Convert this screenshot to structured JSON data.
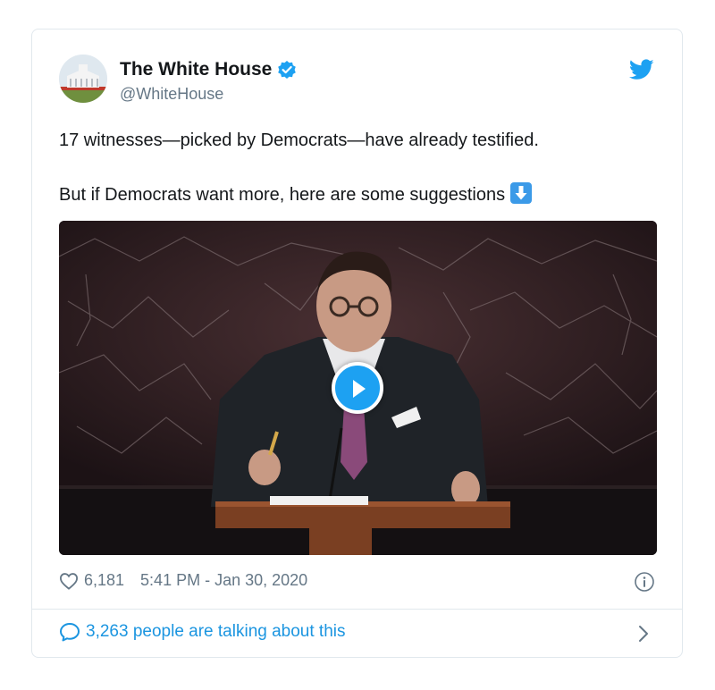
{
  "tweet": {
    "display_name": "The White House",
    "handle": "@WhiteHouse",
    "text_line1": "17 witnesses—picked by Democrats—have already testified.",
    "text_line2": "But if Democrats want more, here are some suggestions",
    "likes": "6,181",
    "timestamp": "5:41 PM - Jan 30, 2020",
    "talking": "3,263 people are talking about this"
  },
  "icons": {
    "verified": "verified-badge-icon",
    "logo": "twitter-bird-icon",
    "emoji": "down-arrow-emoji-icon",
    "play": "play-icon",
    "like": "heart-icon",
    "info": "info-icon",
    "reply": "speech-bubble-icon",
    "next": "chevron-right-icon"
  },
  "colors": {
    "accent": "#1da1f2",
    "link": "#1b95e0",
    "secondary_text": "#657786",
    "border": "#e1e8ed"
  }
}
